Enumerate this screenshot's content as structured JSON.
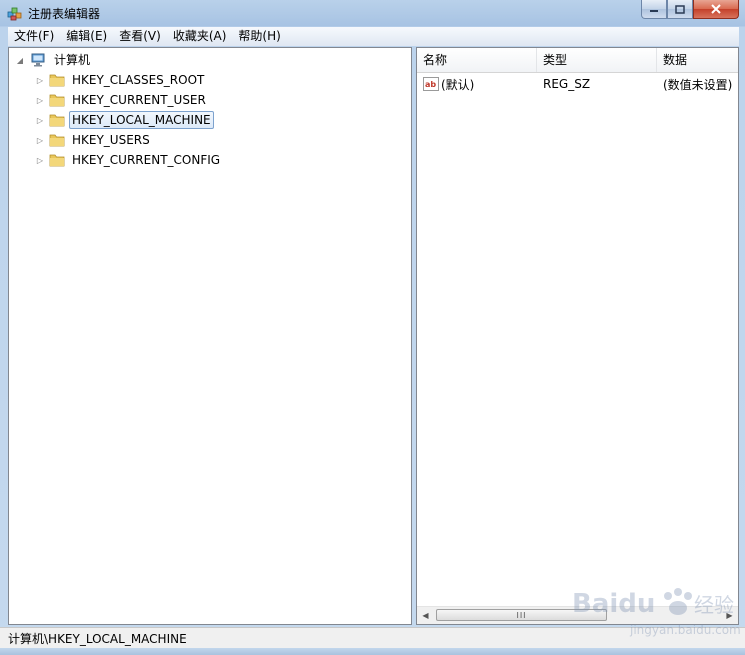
{
  "window": {
    "title": "注册表编辑器"
  },
  "menu": [
    "文件(F)",
    "编辑(E)",
    "查看(V)",
    "收藏夹(A)",
    "帮助(H)"
  ],
  "tree": {
    "root": "计算机",
    "items": [
      {
        "label": "HKEY_CLASSES_ROOT",
        "selected": false
      },
      {
        "label": "HKEY_CURRENT_USER",
        "selected": false
      },
      {
        "label": "HKEY_LOCAL_MACHINE",
        "selected": true
      },
      {
        "label": "HKEY_USERS",
        "selected": false
      },
      {
        "label": "HKEY_CURRENT_CONFIG",
        "selected": false
      }
    ]
  },
  "list": {
    "columns": [
      "名称",
      "类型",
      "数据"
    ],
    "rows": [
      {
        "name": "(默认)",
        "type": "REG_SZ",
        "data": "(数值未设置)",
        "icon": "string-value-icon"
      }
    ],
    "scrollbar": {
      "thumb_label": "III"
    }
  },
  "status": {
    "path": "计算机\\HKEY_LOCAL_MACHINE"
  },
  "watermark": {
    "brand": "Baidu",
    "sub": "经验",
    "url": "jingyan.baidu.com"
  },
  "colors": {
    "selection_border": "#7da2ce",
    "folder": "#e8c65a",
    "close_button": "#c4402a",
    "title_bar": "#b9d1ea"
  }
}
